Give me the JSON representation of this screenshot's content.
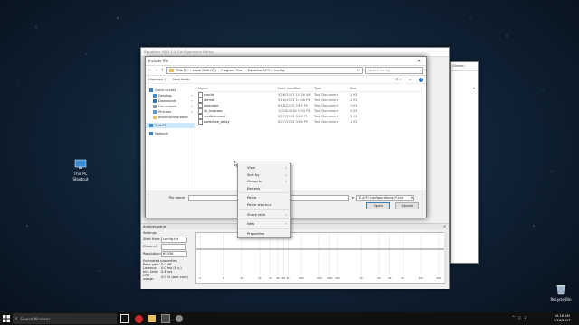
{
  "desktop": {
    "this_pc_label": "This PC",
    "shortcut_label": "Shortcut",
    "recycle_bin_label": "Recycle Bin"
  },
  "editor_window": {
    "title": "Equalizer APO 1.2 Configuration Editor"
  },
  "dialog": {
    "title": "Include file",
    "breadcrumb": [
      "This PC",
      "Local Disk (C:)",
      "Program Files",
      "EqualizerAPO",
      "config"
    ],
    "search_placeholder": "Search config",
    "organize_label": "Organize",
    "new_folder_label": "New folder",
    "nav": [
      {
        "label": "Quick access",
        "icon": "star-icon",
        "pinned": false
      },
      {
        "label": "Desktop",
        "icon": "desktop-icon",
        "pinned": true
      },
      {
        "label": "Downloads",
        "icon": "download-icon",
        "pinned": true
      },
      {
        "label": "Documents",
        "icon": "documents-icon",
        "pinned": true
      },
      {
        "label": "Pictures",
        "icon": "pictures-icon",
        "pinned": true
      },
      {
        "label": "BandicamPortable",
        "icon": "folder-icon",
        "pinned": false
      },
      {
        "label": "This PC",
        "icon": "pc-icon",
        "pinned": false,
        "selected": true
      },
      {
        "label": "Network",
        "icon": "network-icon",
        "pinned": false
      }
    ],
    "columns": {
      "name": "Name",
      "date": "Date modified",
      "type": "Type",
      "size": "Size"
    },
    "files": [
      {
        "name": "config",
        "date": "9/26/2017 10:16 AM",
        "type": "Text Document",
        "size": "1 KB"
      },
      {
        "name": "demo",
        "date": "5/16/2013 10:08 PM",
        "type": "Text Document",
        "size": "2 KB"
      },
      {
        "name": "example",
        "date": "8/18/2012 5:43 PM",
        "type": "Text Document",
        "size": "1 KB"
      },
      {
        "name": "iir_lowpass",
        "date": "10/16/2016 9:03 PM",
        "type": "Text Document",
        "size": "1 KB"
      },
      {
        "name": "multichannel",
        "date": "6/27/2015 3:36 PM",
        "type": "Text Document",
        "size": "1 KB"
      },
      {
        "name": "selective_delay",
        "date": "6/27/2015 3:36 PM",
        "type": "Text Document",
        "size": "1 KB"
      }
    ],
    "file_name_label": "File name:",
    "filter_value": "E-APO configurations (*.txt)",
    "open_label": "Open",
    "cancel_label": "Cancel"
  },
  "context_menu": {
    "items": [
      {
        "label": "View",
        "submenu": true
      },
      {
        "label": "Sort by",
        "submenu": true
      },
      {
        "label": "Group by",
        "submenu": true
      },
      {
        "label": "Refresh",
        "submenu": false
      },
      {
        "separator": true
      },
      {
        "label": "Paste",
        "submenu": false
      },
      {
        "label": "Paste shortcut",
        "submenu": false
      },
      {
        "separator": true
      },
      {
        "label": "Share with",
        "submenu": true
      },
      {
        "separator": true
      },
      {
        "label": "New",
        "submenu": true
      },
      {
        "separator": true
      },
      {
        "label": "Properties",
        "submenu": false
      }
    ]
  },
  "analysis": {
    "title": "Analysis panel",
    "settings_label": "Settings",
    "start_from_label": "Start from:",
    "start_from_value": "config.txt",
    "channel_label": "Channel:",
    "resolution_label": "Resolution:",
    "resolution_value": "65536",
    "estimated_label": "Estimated properties",
    "peak_gain_label": "Peak gain:",
    "peak_gain_value": "0.0 dB",
    "latency_label": "Latency:",
    "latency_value": "0.0 ms (0 s.)",
    "init_time_label": "Init. time:",
    "init_time_value": "0.4 ms",
    "cpu_label": "CPU usage:",
    "cpu_value": "0.0 % (one core)",
    "x_ticks": [
      "2",
      "5",
      "10",
      "20",
      "30",
      "40",
      "50",
      "60",
      "100",
      "200",
      "300",
      "400",
      "1k",
      "2k",
      "3k",
      "5k",
      "10k",
      "20k"
    ]
  },
  "right_window": {
    "address_value": "(Stereo)"
  },
  "taskbar": {
    "search_placeholder": "Search Windows",
    "time": "10:16 AM",
    "date": "9/26/2017"
  }
}
